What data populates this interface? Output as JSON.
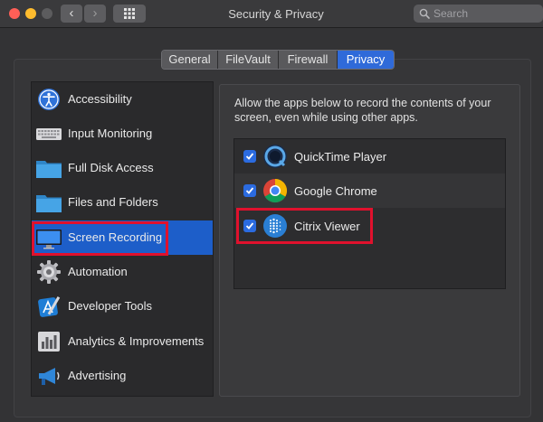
{
  "window": {
    "title": "Security & Privacy",
    "search_placeholder": "Search"
  },
  "toolbar": {
    "back_glyph": "‹",
    "forward_glyph": "›"
  },
  "tabs": [
    {
      "label": "General",
      "active": false
    },
    {
      "label": "FileVault",
      "active": false
    },
    {
      "label": "Firewall",
      "active": false
    },
    {
      "label": "Privacy",
      "active": true
    }
  ],
  "sidebar": {
    "items": [
      {
        "label": "Accessibility",
        "icon": "accessibility-icon",
        "selected": false
      },
      {
        "label": "Input Monitoring",
        "icon": "keyboard-icon",
        "selected": false
      },
      {
        "label": "Full Disk Access",
        "icon": "folder-icon",
        "selected": false
      },
      {
        "label": "Files and Folders",
        "icon": "folder-icon",
        "selected": false
      },
      {
        "label": "Screen Recording",
        "icon": "display-icon",
        "selected": true
      },
      {
        "label": "Automation",
        "icon": "gear-icon",
        "selected": false
      },
      {
        "label": "Developer Tools",
        "icon": "developer-tools-icon",
        "selected": false
      },
      {
        "label": "Analytics & Improvements",
        "icon": "analytics-icon",
        "selected": false
      },
      {
        "label": "Advertising",
        "icon": "megaphone-icon",
        "selected": false
      }
    ]
  },
  "main": {
    "description": "Allow the apps below to record the contents of your screen, even while using other apps.",
    "apps": [
      {
        "name": "QuickTime Player",
        "checked": true,
        "icon": "quicktime-icon"
      },
      {
        "name": "Google Chrome",
        "checked": true,
        "icon": "chrome-icon"
      },
      {
        "name": "Citrix Viewer",
        "checked": true,
        "icon": "citrix-icon"
      }
    ]
  },
  "colors": {
    "accent": "#2f6ad9",
    "selection": "#1d5ec9",
    "highlight_box": "#e0112d"
  }
}
